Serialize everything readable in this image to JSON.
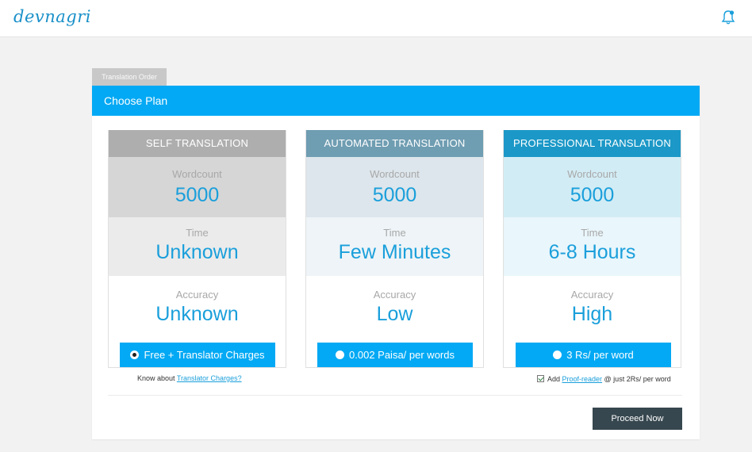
{
  "header": {
    "logo": "devnagri",
    "notification_icon": "bell-icon"
  },
  "tab": {
    "label": "Translation Order"
  },
  "card": {
    "title": "Choose Plan"
  },
  "plans": [
    {
      "name": "SELF TRANSLATION",
      "wordcount_label": "Wordcount",
      "wordcount": "5000",
      "time_label": "Time",
      "time": "Unknown",
      "accuracy_label": "Accuracy",
      "accuracy": "Unknown",
      "price": "Free + Translator Charges",
      "selected": true,
      "header_color": "#aeaeae"
    },
    {
      "name": "AUTOMATED TRANSLATION",
      "wordcount_label": "Wordcount",
      "wordcount": "5000",
      "time_label": "Time",
      "time": "Few Minutes",
      "accuracy_label": "Accuracy",
      "accuracy": "Low",
      "price": "0.002 Paisa/ per words",
      "selected": false,
      "header_color": "#6f9db2"
    },
    {
      "name": "PROFESSIONAL TRANSLATION",
      "wordcount_label": "Wordcount",
      "wordcount": "5000",
      "time_label": "Time",
      "time": "6-8 Hours",
      "accuracy_label": "Accuracy",
      "accuracy": "High",
      "price": "3 Rs/ per word",
      "selected": false,
      "header_color": "#1b98c7"
    }
  ],
  "notes": {
    "self": {
      "prefix": "Know about ",
      "link": "Translator Charges?"
    },
    "professional": {
      "prefix": "Add ",
      "link": "Proof-reader",
      "suffix": " @ just 2Rs/ per word",
      "checked": true
    }
  },
  "actions": {
    "proceed": "Proceed Now"
  },
  "colors": {
    "accent": "#03a9f4",
    "value_text": "#1a9fdb",
    "proceed_bg": "#37474f"
  }
}
